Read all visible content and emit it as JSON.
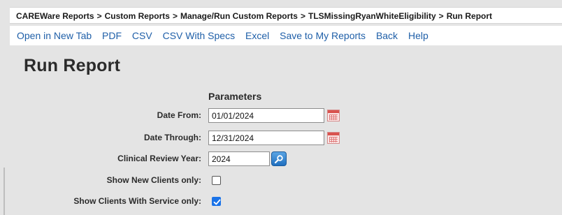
{
  "breadcrumb": {
    "items": [
      "CAREWare Reports",
      "Custom Reports",
      "Manage/Run Custom Reports",
      "TLSMissingRyanWhiteEligibility",
      "Run Report"
    ],
    "separator": ">"
  },
  "menu": {
    "items": [
      "Open in New Tab",
      "PDF",
      "CSV",
      "CSV With Specs",
      "Excel",
      "Save to My Reports",
      "Back",
      "Help"
    ]
  },
  "page": {
    "title": "Run Report",
    "params_heading": "Parameters"
  },
  "params": {
    "date_from": {
      "label": "Date From:",
      "value": "01/01/2024"
    },
    "date_through": {
      "label": "Date Through:",
      "value": "12/31/2024"
    },
    "clinical_review_year": {
      "label": "Clinical Review Year:",
      "value": "2024"
    },
    "show_new_clients": {
      "label": "Show New Clients only:",
      "checked": false
    },
    "show_clients_with_service": {
      "label": "Show Clients With Service only:",
      "checked": true
    }
  },
  "colors": {
    "background": "#e4e4e4",
    "link": "#1f5fa8",
    "checkbox_checked": "#1a73e8",
    "lookup_button": "#1f6fbf",
    "calendar_icon": "#d9534f"
  },
  "icons": {
    "calendar": "calendar-icon",
    "lookup": "search-lookup-icon",
    "checkmark": "check-icon"
  }
}
